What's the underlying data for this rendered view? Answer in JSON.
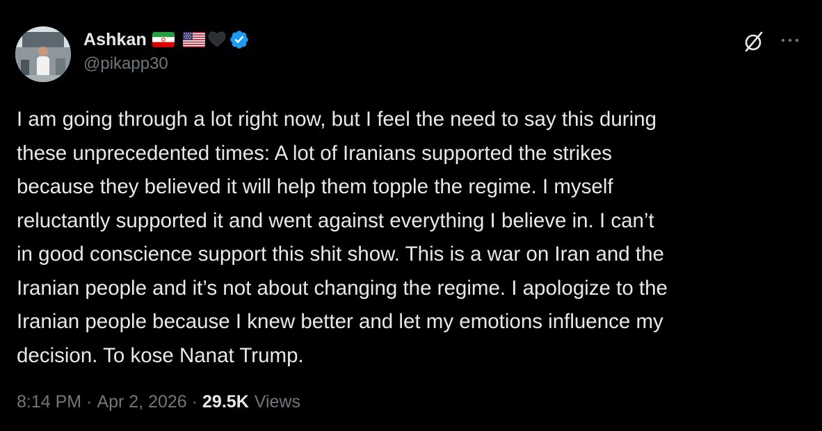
{
  "author": {
    "display_name": "Ashkan",
    "handle": "@pikapp30",
    "verified": true,
    "emojis": [
      "iran-flag-icon",
      "us-flag-icon",
      "black-heart-icon"
    ]
  },
  "actions": {
    "grok_icon": "grok-icon",
    "more_icon": "more-icon"
  },
  "tweet": {
    "text": "I am going through a lot right now, but I feel the need to say this during\nthese unprecedented times: A lot of Iranians supported the strikes\nbecause they believed it will help them topple the regime. I myself\nreluctantly supported it and went against everything I believe in. I can’t\nin good conscience support this shit show. This is a war on Iran and the\nIranian people and it’s not about changing the regime. I apologize to the\nIranian people because I knew better and let my emotions influence my\ndecision. To kose Nanat Trump."
  },
  "meta": {
    "time": "8:14 PM",
    "separator": "·",
    "date": "Apr 2, 2026",
    "views_count": "29.5K",
    "views_label": "Views"
  },
  "colors": {
    "background": "#000000",
    "text": "#e7e9ea",
    "secondary": "#71767b",
    "verified": "#1d9bf0"
  }
}
